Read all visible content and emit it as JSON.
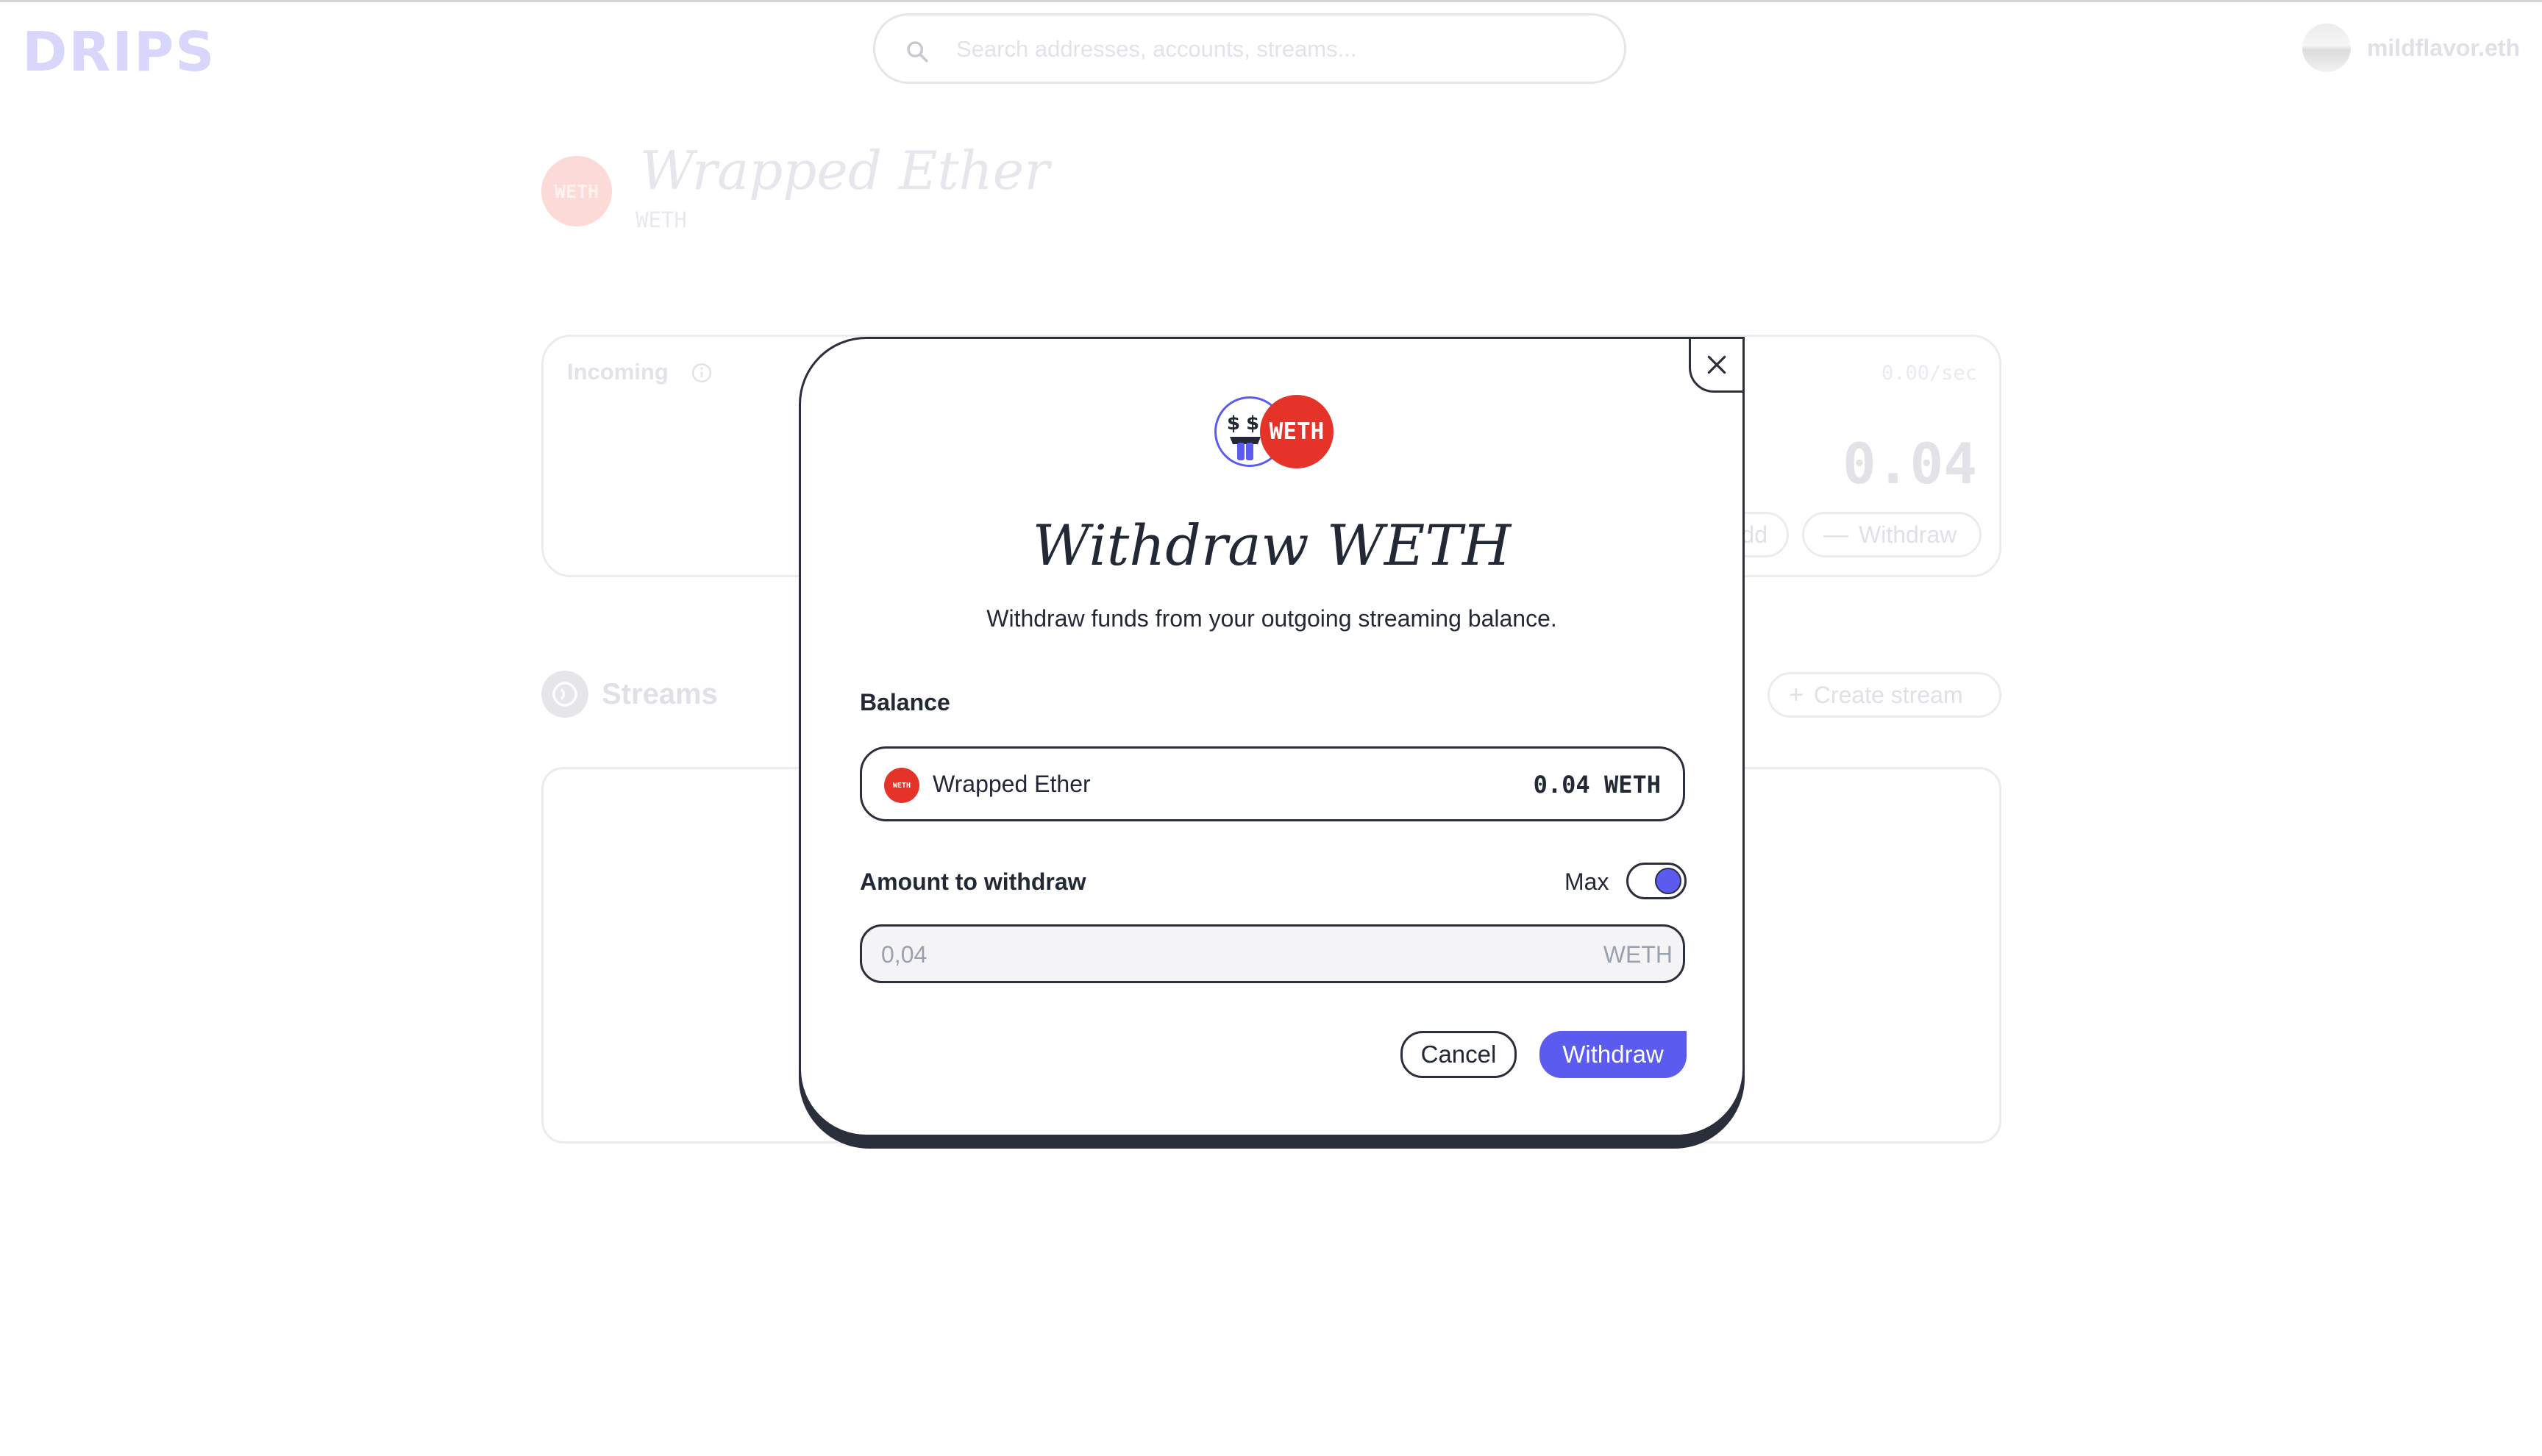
{
  "header": {
    "logo": "DRIPS",
    "search": {
      "placeholder": "Search addresses, accounts, streams...",
      "value": ""
    },
    "account": {
      "name": "mildflavor.eth"
    }
  },
  "token": {
    "badge": "WETH",
    "name": "Wrapped Ether",
    "symbol": "WETH"
  },
  "balance_card": {
    "incoming_label": "Incoming",
    "outgoing_rate": "0.00/sec",
    "outgoing_amount": "0.04",
    "add_label": "Add",
    "withdraw_label": "Withdraw"
  },
  "streams": {
    "title": "Streams",
    "create_label": "Create stream"
  },
  "modal": {
    "token_badge": "WETH",
    "title": "Withdraw WETH",
    "subtitle": "Withdraw funds from your outgoing streaming balance.",
    "balance_label": "Balance",
    "balance_token_badge": "WETH",
    "balance_token_name": "Wrapped Ether",
    "balance_amount": "0.04 WETH",
    "amount_label": "Amount to withdraw",
    "max_label": "Max",
    "max_enabled": true,
    "amount_placeholder": "0,04",
    "amount_value": "",
    "amount_unit": "WETH",
    "cancel_label": "Cancel",
    "withdraw_label": "Withdraw"
  },
  "colors": {
    "accent": "#5b5bf0",
    "weth_red": "#e63329",
    "outline": "#2a2f3b"
  }
}
